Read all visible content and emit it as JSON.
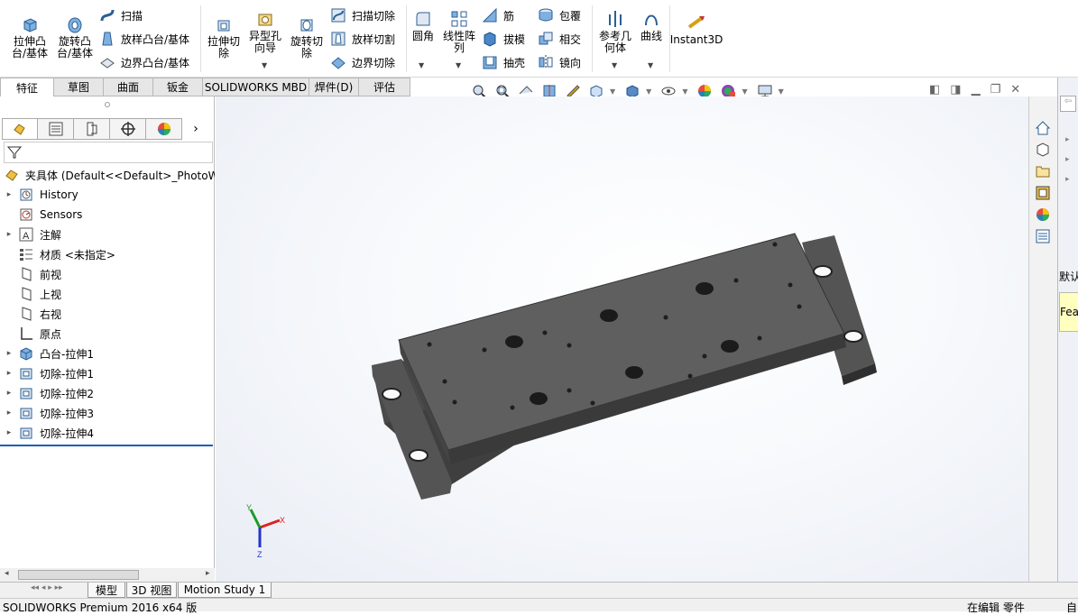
{
  "ribbon": {
    "extrude_boss": "拉伸凸台/基体",
    "revolve_boss": "旋转凸台/基体",
    "sweep": "扫描",
    "loft_boss": "放样凸台/基体",
    "boundary_boss": "边界凸台/基体",
    "extrude_cut": "拉伸切除",
    "hole_wizard": "异型孔向导",
    "revolve_cut": "旋转切除",
    "swept_cut": "扫描切除",
    "lofted_cut": "放样切割",
    "boundary_cut": "边界切除",
    "fillet": "圆角",
    "linear_pattern": "线性阵列",
    "rib": "筋",
    "draft": "拔模",
    "shell": "抽壳",
    "wrap": "包覆",
    "intersect": "相交",
    "mirror": "镜向",
    "ref_geometry": "参考几何体",
    "curves": "曲线",
    "instant3d": "Instant3D"
  },
  "tabs": [
    "特征",
    "草图",
    "曲面",
    "钣金",
    "SOLIDWORKS MBD",
    "焊件(D)",
    "评估"
  ],
  "tree": {
    "root": "夹具体  (Default<<Default>_PhotoWorks",
    "items": [
      {
        "label": "History",
        "icon": "history-icon",
        "expand": true
      },
      {
        "label": "Sensors",
        "icon": "sensors-icon",
        "expand": false
      },
      {
        "label": "注解",
        "icon": "annotations-icon",
        "expand": true
      },
      {
        "label": "材质 <未指定>",
        "icon": "material-icon",
        "expand": false
      },
      {
        "label": "前视",
        "icon": "plane-icon",
        "expand": false
      },
      {
        "label": "上视",
        "icon": "plane-icon",
        "expand": false
      },
      {
        "label": "右视",
        "icon": "plane-icon",
        "expand": false
      },
      {
        "label": "原点",
        "icon": "origin-icon",
        "expand": false
      },
      {
        "label": "凸台-拉伸1",
        "icon": "boss-extrude-icon",
        "expand": true
      },
      {
        "label": "切除-拉伸1",
        "icon": "cut-extrude-icon",
        "expand": true
      },
      {
        "label": "切除-拉伸2",
        "icon": "cut-extrude-icon",
        "expand": true
      },
      {
        "label": "切除-拉伸3",
        "icon": "cut-extrude-icon",
        "expand": true
      },
      {
        "label": "切除-拉伸4",
        "icon": "cut-extrude-icon",
        "expand": true
      }
    ]
  },
  "bottom_tabs": [
    "模型",
    "3D 视图",
    "Motion Study 1"
  ],
  "status": {
    "left": "SOLIDWORKS Premium 2016 x64 版",
    "mode": "在编辑 零件",
    "extra": "自"
  },
  "triad": {
    "x": "X",
    "y": "Y",
    "z": "Z"
  },
  "far_right": {
    "label1": "默认",
    "label2": "Fea"
  },
  "colors": {
    "accent": "#1a5fb4",
    "model": "#5a5a5a"
  }
}
